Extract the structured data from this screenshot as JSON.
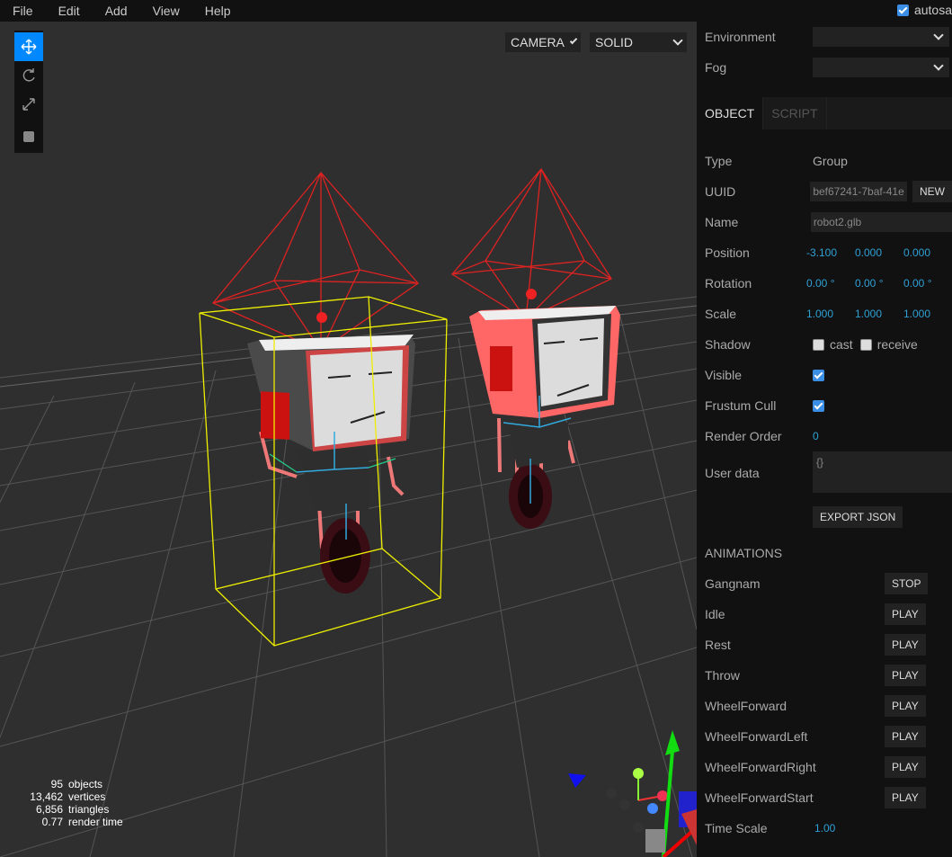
{
  "menubar": {
    "items": [
      "File",
      "Edit",
      "Add",
      "View",
      "Help"
    ],
    "autosave_label": "autosa",
    "autosave_checked": true
  },
  "viewport": {
    "camera_select": "CAMERA",
    "shading_select": "SOLID",
    "tools": [
      "translate-icon",
      "rotate-icon",
      "scale-icon",
      "local-space-icon"
    ],
    "info": [
      {
        "value": "95",
        "label": "objects"
      },
      {
        "value": "13,462",
        "label": "vertices"
      },
      {
        "value": "6,856",
        "label": "triangles"
      },
      {
        "value": "0.77",
        "label": "render time"
      }
    ]
  },
  "sidebar": {
    "scene": {
      "environment_label": "Environment",
      "environment_value": "",
      "fog_label": "Fog",
      "fog_value": ""
    },
    "tabs": [
      "OBJECT",
      "SCRIPT"
    ],
    "object": {
      "type_label": "Type",
      "type_value": "Group",
      "uuid_label": "UUID",
      "uuid_value": "bef67241-7baf-41e",
      "new_label": "NEW",
      "name_label": "Name",
      "name_value": "robot2.glb",
      "position_label": "Position",
      "position": [
        "-3.100",
        "0.000",
        "0.000"
      ],
      "rotation_label": "Rotation",
      "rotation": [
        "0.00 °",
        "0.00 °",
        "0.00 °"
      ],
      "scale_label": "Scale",
      "scale": [
        "1.000",
        "1.000",
        "1.000"
      ],
      "shadow_label": "Shadow",
      "cast_label": "cast",
      "receive_label": "receive",
      "visible_label": "Visible",
      "frustum_label": "Frustum Cull",
      "render_order_label": "Render Order",
      "render_order_value": "0",
      "userdata_label": "User data",
      "userdata_value": "{}",
      "export_label": "EXPORT JSON"
    },
    "animations": {
      "title": "ANIMATIONS",
      "items": [
        {
          "name": "Gangnam",
          "action": "STOP"
        },
        {
          "name": "Idle",
          "action": "PLAY"
        },
        {
          "name": "Rest",
          "action": "PLAY"
        },
        {
          "name": "Throw",
          "action": "PLAY"
        },
        {
          "name": "WheelForward",
          "action": "PLAY"
        },
        {
          "name": "WheelForwardLeft",
          "action": "PLAY"
        },
        {
          "name": "WheelForwardRight",
          "action": "PLAY"
        },
        {
          "name": "WheelForwardStart",
          "action": "PLAY"
        }
      ],
      "timescale_label": "Time Scale",
      "timescale_value": "1.00"
    }
  }
}
